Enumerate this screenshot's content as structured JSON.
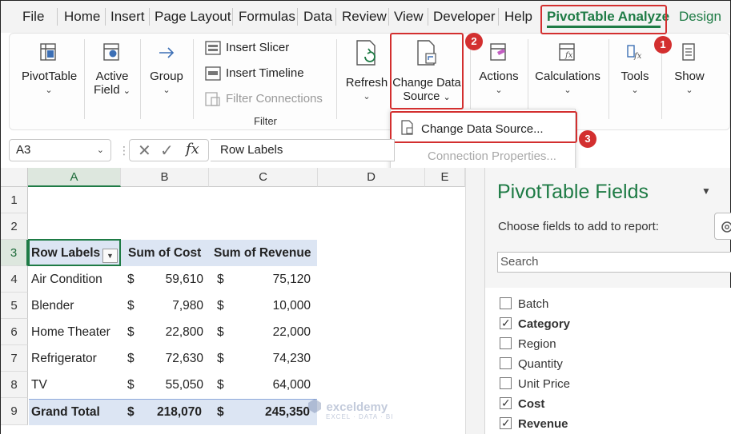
{
  "menu": {
    "items": [
      "File",
      "Home",
      "Insert",
      "Page Layout",
      "Formulas",
      "Data",
      "Review",
      "View",
      "Developer",
      "Help",
      "PivotTable Analyze",
      "Design"
    ],
    "active": "PivotTable Analyze",
    "accent_color": "#1e7b45"
  },
  "ribbon": {
    "pivottable_label": "PivotTable",
    "active_field_label_1": "Active",
    "active_field_label_2": "Field",
    "group_label": "Group",
    "insert_slicer": "Insert Slicer",
    "insert_timeline": "Insert Timeline",
    "filter_connections": "Filter Connections",
    "filter_group_label": "Filter",
    "refresh_label": "Refresh",
    "change_data_label_1": "Change Data",
    "change_data_label_2": "Source",
    "actions_label": "Actions",
    "calculations_label": "Calculations",
    "tools_label": "Tools",
    "show_label": "Show"
  },
  "dropdown": {
    "change_data_source": "Change Data Source...",
    "connection_properties": "Connection Properties..."
  },
  "callouts": {
    "one": "1",
    "two": "2",
    "three": "3",
    "color": "#d32f2f"
  },
  "formula_bar": {
    "name_box": "A3",
    "fx": "fx",
    "content": "Row Labels"
  },
  "sheet": {
    "columns": [
      "A",
      "B",
      "C",
      "D",
      "E"
    ],
    "rows": [
      "1",
      "2",
      "3",
      "4",
      "5",
      "6",
      "7",
      "8",
      "9"
    ],
    "headers": [
      "Row Labels",
      "Sum of Cost",
      "Sum of Revenue"
    ],
    "currency": "$",
    "data": [
      {
        "label": "Air Condition",
        "cost": "59,610",
        "revenue": "75,120"
      },
      {
        "label": "Blender",
        "cost": "7,980",
        "revenue": "10,000"
      },
      {
        "label": "Home Theater",
        "cost": "22,800",
        "revenue": "22,000"
      },
      {
        "label": "Refrigerator",
        "cost": "72,630",
        "revenue": "74,230"
      },
      {
        "label": "TV",
        "cost": "55,050",
        "revenue": "64,000"
      }
    ],
    "total": {
      "label": "Grand Total",
      "cost": "218,070",
      "revenue": "245,350"
    }
  },
  "pane": {
    "title": "PivotTable Fields",
    "subtitle": "Choose fields to add to report:",
    "search_placeholder": "Search",
    "fields": [
      {
        "name": "Batch",
        "checked": false
      },
      {
        "name": "Category",
        "checked": true
      },
      {
        "name": "Region",
        "checked": false
      },
      {
        "name": "Quantity",
        "checked": false
      },
      {
        "name": "Unit Price",
        "checked": false
      },
      {
        "name": "Cost",
        "checked": true
      },
      {
        "name": "Revenue",
        "checked": true
      }
    ]
  },
  "watermark": {
    "name": "exceldemy",
    "sub": "EXCEL · DATA · BI"
  }
}
